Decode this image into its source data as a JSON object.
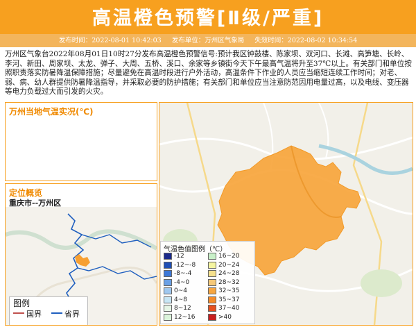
{
  "header": {
    "title": "高温橙色预警[Ⅱ级/严重]",
    "publish_time_label": "发布时间：2022-08-01 10:42:03",
    "publisher_label": "发布单位：万州区气象局",
    "expire_label": "失效时间：2022-08-02 10:34:54"
  },
  "description": "万州区气象台2022年08月01日10时27分发布高温橙色预警信号:预计我区钟鼓楼、陈家坝、双河口、长滩、高笋塘、长岭、李河、新田、周家坝、太龙、弹子、大周、五桥、溪口、余家等乡镇街今天下午最高气温将升至37℃以上。有关部门和单位按照职责落实防暑降温保障措施；尽量避免在高温时段进行户外活动，高温条件下作业的人员应当缩短连续工作时间；对老、弱、病、幼人群提供防暑降温指导，并采取必要的防护措施；有关部门和单位应当注意防范因用电量过高，以及电线、变压器等电力负载过大而引发的火灾。",
  "temp_panel": {
    "title": "万州当地气温实况(℃)"
  },
  "location_panel": {
    "title": "定位概览",
    "region": "重庆市--万州区",
    "legend_title": "图例",
    "legend_items": [
      {
        "label": "国界",
        "color": "#c0504d"
      },
      {
        "label": "省界",
        "color": "#1f5fbf"
      }
    ]
  },
  "map": {
    "legend_title": "气温色值图例（℃）",
    "legend_items": [
      {
        "label": "-12",
        "color": "#1a2a8c"
      },
      {
        "label": "16~20",
        "color": "#c8f0c8"
      },
      {
        "label": "-12~-8",
        "color": "#1f4fb5"
      },
      {
        "label": "20~24",
        "color": "#f5f5a0"
      },
      {
        "label": "-8~-4",
        "color": "#3c78d8"
      },
      {
        "label": "24~28",
        "color": "#f5e08c"
      },
      {
        "label": "-4~0",
        "color": "#6aa0e6"
      },
      {
        "label": "28~32",
        "color": "#f5c878"
      },
      {
        "label": "0~4",
        "color": "#a0c8f0"
      },
      {
        "label": "32~35",
        "color": "#f7a640"
      },
      {
        "label": "4~8",
        "color": "#c8e6f5"
      },
      {
        "label": "35~37",
        "color": "#f58c28"
      },
      {
        "label": "8~12",
        "color": "#e6f5e6"
      },
      {
        "label": "37~40",
        "color": "#e6501e"
      },
      {
        "label": "12~16",
        "color": "#dcf5dc"
      },
      {
        "label": ">40",
        "color": "#c81e1e"
      }
    ],
    "region_color": "#f7a032"
  }
}
